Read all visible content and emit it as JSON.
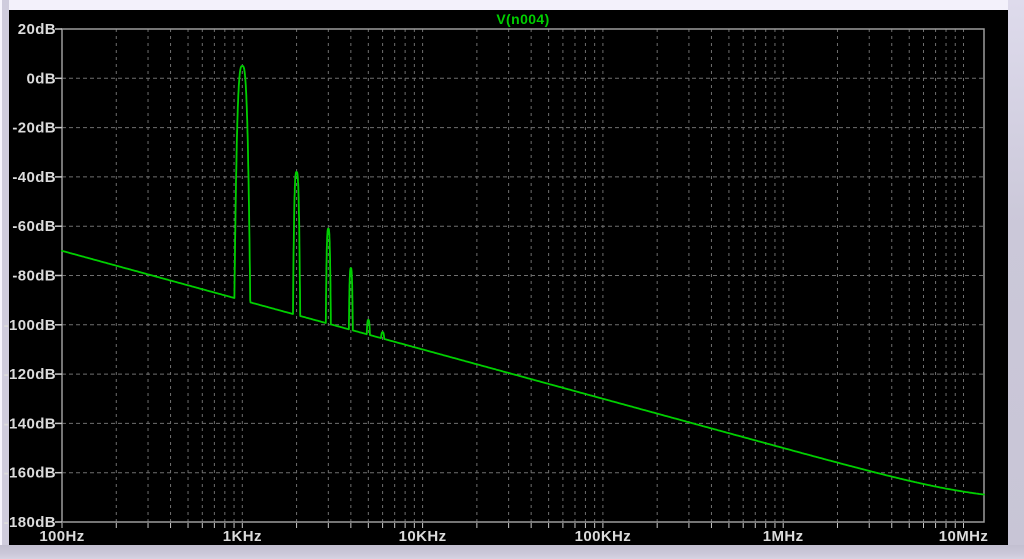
{
  "trace": {
    "name": "V(n004)",
    "color": "#00cf00"
  },
  "colors": {
    "pane_background": "#000000",
    "window_frame": "#cfccdd",
    "grid": "#6f6f6f",
    "axis_box": "#9c9c9c",
    "tick": "#c8c8c8",
    "labels": "#dcdcdc",
    "trace_green": "#00cf00"
  },
  "chart_data": {
    "type": "line",
    "title": "V(n004)",
    "legend_position": "top-center",
    "grid": true,
    "x_axis": {
      "scale": "log",
      "unit": "Hz",
      "range_hz": [
        100,
        13000000
      ],
      "tick_hz": [
        100,
        1000,
        10000,
        100000,
        1000000,
        10000000
      ],
      "tick_labels": [
        "100Hz",
        "1KHz",
        "10KHz",
        "100KHz",
        "1MHz",
        "10MHz"
      ],
      "minor_gridlines_per_decade": [
        2,
        3,
        4,
        5,
        6,
        7,
        8,
        9
      ]
    },
    "y_axis": {
      "unit": "dB",
      "range_db": [
        -180,
        20
      ],
      "tick_step_db": 20,
      "tick_db": [
        20,
        0,
        -20,
        -40,
        -60,
        -80,
        -100,
        -120,
        -140,
        -160,
        -180
      ],
      "tick_labels": [
        "20dB",
        "0dB",
        "-20dB",
        "-40dB",
        "-60dB",
        "-80dB",
        "-100dB",
        "-120dB",
        "-140dB",
        "-160dB",
        "-180dB"
      ]
    },
    "series": [
      {
        "name": "V(n004)",
        "color": "#00cf00",
        "baseline": {
          "db_at_100hz": -70,
          "slope_db_per_decade": -20,
          "floor_db": -171.5
        },
        "peaks": [
          {
            "hz": 1000,
            "db": 5,
            "half_width_decades": 0.044
          },
          {
            "hz": 2000,
            "db": -38,
            "half_width_decades": 0.02
          },
          {
            "hz": 3000,
            "db": -61,
            "half_width_decades": 0.014
          },
          {
            "hz": 4000,
            "db": -77,
            "half_width_decades": 0.011
          },
          {
            "hz": 5000,
            "db": -98,
            "half_width_decades": 0.009
          },
          {
            "hz": 6000,
            "db": -103,
            "half_width_decades": 0.009
          }
        ]
      }
    ]
  }
}
